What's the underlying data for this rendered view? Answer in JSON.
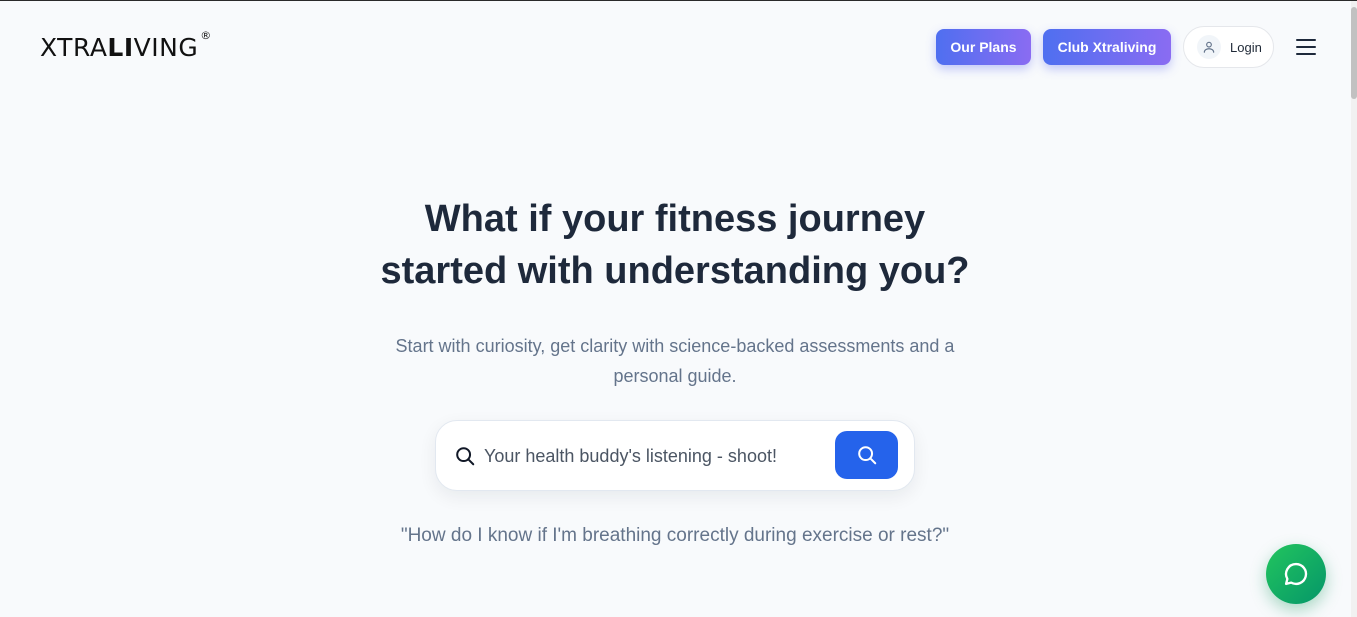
{
  "header": {
    "logo_light": "XTRA",
    "logo_bold": "LI",
    "logo_rest": "VING",
    "logo_registered": "®",
    "plans_label": "Our Plans",
    "club_label": "Club Xtraliving",
    "login_label": "Login",
    "user_icon": "user-icon",
    "menu_icon": "hamburger-menu-icon"
  },
  "hero": {
    "headline_line1": "What if your fitness journey",
    "headline_line2": "started with understanding you?",
    "subtext_line1": "Start with curiosity, get clarity with science-backed assessments and a",
    "subtext_line2": "personal guide."
  },
  "search": {
    "placeholder": "Your health buddy's listening - shoot!",
    "leading_icon": "search-icon",
    "button_icon": "search-icon"
  },
  "example_question": "\"How do I know if I'm breathing correctly during exercise or rest?\"",
  "chat": {
    "icon": "chat-bubble-icon"
  },
  "colors": {
    "accent_blue": "#2563eb",
    "gradient_start": "#4f6ff0",
    "gradient_end": "#8a6cf2",
    "chat_green": "#16a34a",
    "headline": "#1e293b",
    "muted": "#64748b",
    "background": "#f8fafc"
  }
}
